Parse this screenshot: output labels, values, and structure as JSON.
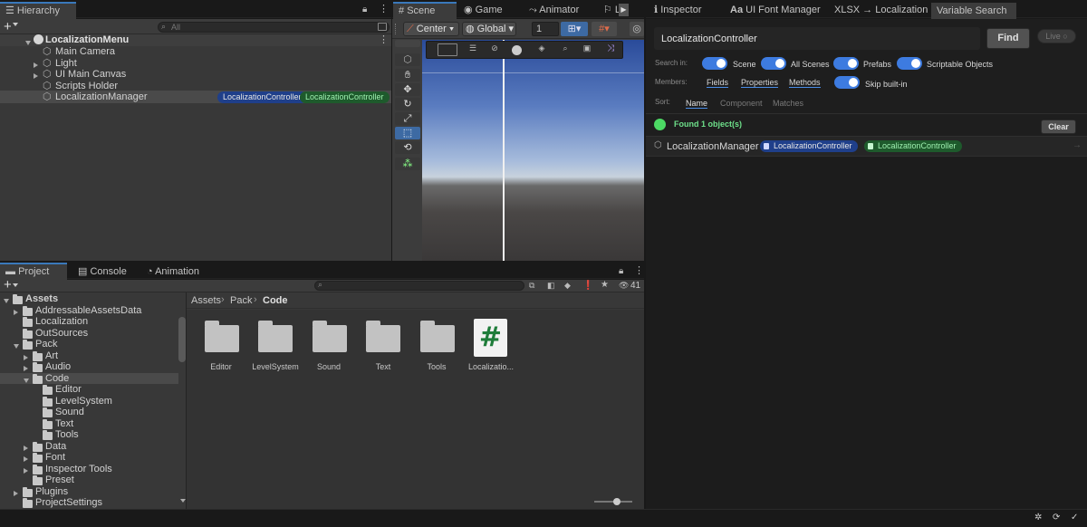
{
  "hierarchy": {
    "tab": "Hierarchy",
    "search_placeholder": "All",
    "scene": "LocalizationMenu",
    "items": [
      "Main Camera",
      "Light",
      "UI Main Canvas",
      "Scripts Holder",
      "LocalizationManager"
    ],
    "badges": [
      "LocalizationController",
      "LocalizationController"
    ]
  },
  "scene_view": {
    "tabs": [
      "Scene",
      "Game",
      "Animator"
    ],
    "pivot": "Center",
    "space": "Global",
    "value": "1"
  },
  "project": {
    "tabs": [
      "Project",
      "Console",
      "Animation"
    ],
    "count": "41",
    "tree": [
      {
        "label": "Assets",
        "depth": 0
      },
      {
        "label": "AddressableAssetsData",
        "depth": 1
      },
      {
        "label": "Localization",
        "depth": 1
      },
      {
        "label": "OutSources",
        "depth": 1
      },
      {
        "label": "Pack",
        "depth": 1
      },
      {
        "label": "Art",
        "depth": 2
      },
      {
        "label": "Audio",
        "depth": 2
      },
      {
        "label": "Code",
        "depth": 2
      },
      {
        "label": "Editor",
        "depth": 3
      },
      {
        "label": "LevelSystem",
        "depth": 3
      },
      {
        "label": "Sound",
        "depth": 3
      },
      {
        "label": "Text",
        "depth": 3
      },
      {
        "label": "Tools",
        "depth": 3
      },
      {
        "label": "Data",
        "depth": 2
      },
      {
        "label": "Font",
        "depth": 2
      },
      {
        "label": "Inspector Tools",
        "depth": 2
      },
      {
        "label": "Preset",
        "depth": 2
      },
      {
        "label": "Plugins",
        "depth": 1
      },
      {
        "label": "ProjectSettings",
        "depth": 1
      }
    ],
    "breadcrumb": [
      "Assets",
      "Pack",
      "Code"
    ],
    "assets": [
      "Editor",
      "LevelSystem",
      "Sound",
      "Text",
      "Tools",
      "Localizatio..."
    ]
  },
  "right": {
    "tabs": [
      "Inspector",
      "UI Font Manager",
      "XLSX → Localization",
      "Variable Search"
    ],
    "query": "LocalizationController",
    "find": "Find",
    "live": "Live ○",
    "search_in_label": "Search in:",
    "search_in": [
      "Scene",
      "All Scenes",
      "Prefabs",
      "Scriptable Objects"
    ],
    "members_label": "Members:",
    "members": [
      "Fields",
      "Properties",
      "Methods"
    ],
    "skip": "Skip built-in",
    "sort_label": "Sort:",
    "sort": [
      "Name",
      "Component",
      "Matches"
    ],
    "found": "Found 1 object(s)",
    "clear": "Clear",
    "result_name": "LocalizationManager",
    "result_badges": [
      "LocalizationController",
      "LocalizationController"
    ]
  },
  "colors": {
    "accent": "#3d7be0",
    "found": "#4cd964",
    "badge_blue": "#1f3f8a",
    "badge_green": "#1e5a2c"
  }
}
